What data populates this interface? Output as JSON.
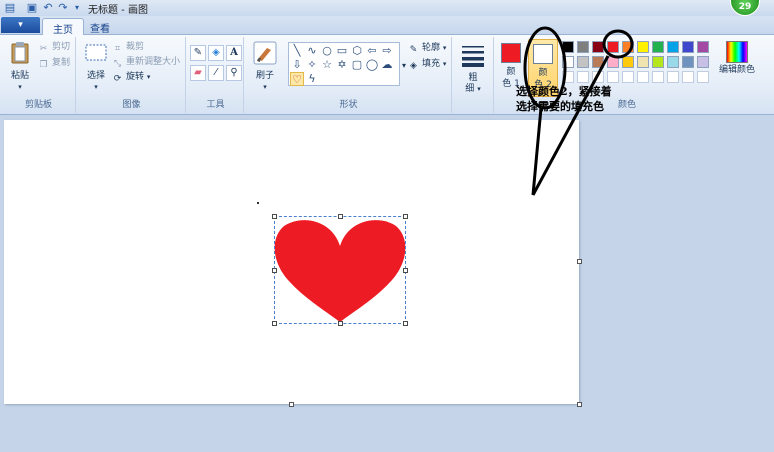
{
  "window": {
    "title": "无标题 - 画图",
    "user_badge": "29"
  },
  "tabs": [
    {
      "label": "主页"
    },
    {
      "label": "查看"
    }
  ],
  "app_menu_label": "▾",
  "groups": {
    "clipboard": {
      "label": "剪贴板",
      "paste": "粘贴",
      "cut": "剪切",
      "copy": "复制"
    },
    "image": {
      "label": "图像",
      "select": "选择",
      "crop": "裁剪",
      "resize": "重新调整大小",
      "rotate": "旋转"
    },
    "tools": {
      "label": "工具",
      "text_glyph": "A"
    },
    "shapes": {
      "label": "形状",
      "brush": "刷子",
      "outline": "轮廓",
      "fill": "填充"
    },
    "size": {
      "label_line1": "粗",
      "label_line2": "细"
    },
    "colors": {
      "label": "颜色",
      "color1_a": "颜",
      "color1_b": "色 1",
      "color2_a": "颜",
      "color2_b": "色 2",
      "edit": "编辑颜色"
    }
  },
  "palette": {
    "color1": "#ed1c24",
    "color2": "#ffffff",
    "row1": [
      "#000000",
      "#7f7f7f",
      "#880015",
      "#ed1c24",
      "#ff7f27",
      "#fff200",
      "#22b14c",
      "#00a2e8",
      "#3f48cc",
      "#a349a4"
    ],
    "row2": [
      "#ffffff",
      "#c3c3c3",
      "#b97a57",
      "#ffaec9",
      "#ffc90e",
      "#efe4b0",
      "#b5e61d",
      "#99d9ea",
      "#7092be",
      "#c8bfe7"
    ]
  },
  "canvas": {
    "heart_color": "#ed1c24"
  },
  "annotation": {
    "line1": "选择颜色2，紧接着",
    "line2": "选择需要的填充色"
  }
}
